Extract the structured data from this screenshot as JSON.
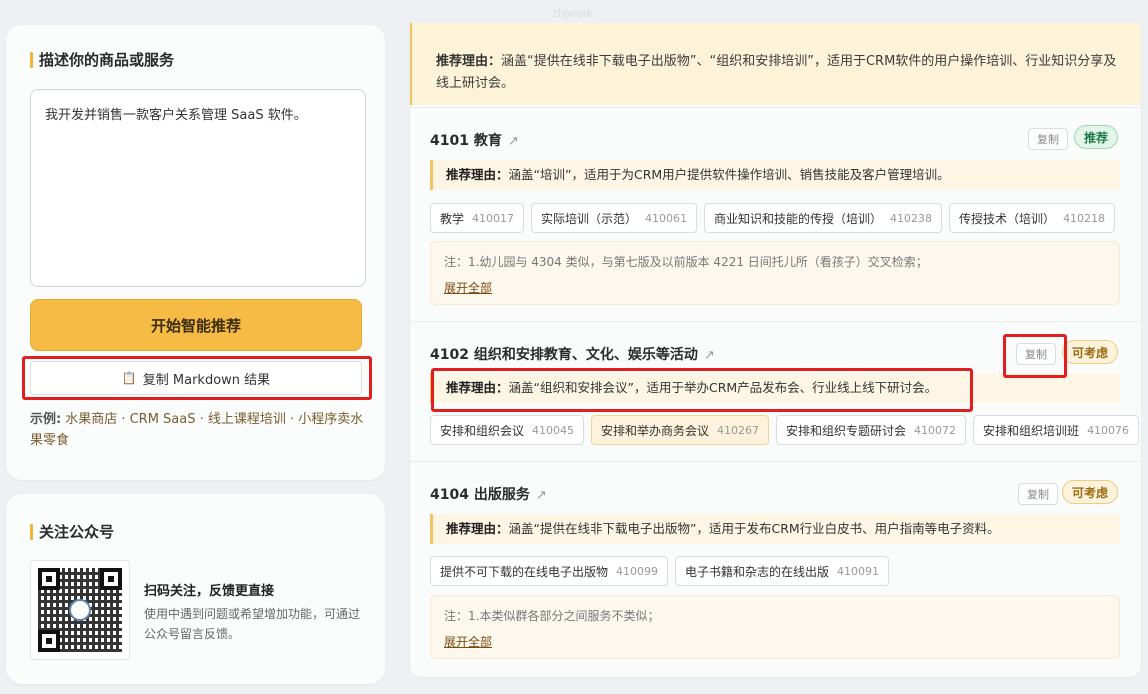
{
  "watermark": "zhjwork",
  "describe": {
    "title": "描述你的商品或服务",
    "input_value": "我开发并销售一款客户关系管理 SaaS 软件。",
    "start_button": "开始智能推荐",
    "copy_md_button": "复制 Markdown 结果",
    "examples_label": "示例:",
    "examples_text": "水果商店 · CRM SaaS · 线上课程培训 · 小程序卖水果零食"
  },
  "wechat": {
    "title": "关注公众号",
    "scan_title": "扫码关注，反馈更直接",
    "scan_desc": "使用中遇到问题或希望增加功能，可通过公众号留言反馈。"
  },
  "top_reason": {
    "label": "推荐理由：",
    "text": "涵盖“提供在线非下载电子出版物”、“组织和安排培训”，适用于CRM软件的用户操作培训、行业知识分享及线上研讨会。"
  },
  "classes": [
    {
      "code_title": "4101 教育",
      "copy_label": "复制",
      "badge": "推荐",
      "reason_label": "推荐理由：",
      "reason_text": "涵盖“培训”，适用于为CRM用户提供软件操作培训、销售技能及客户管理培训。",
      "tags": [
        {
          "name": "教学",
          "code": "410017",
          "highlight": false
        },
        {
          "name": "实际培训（示范）",
          "code": "410061",
          "highlight": false
        },
        {
          "name": "商业知识和技能的传授（培训）",
          "code": "410238",
          "highlight": false
        },
        {
          "name": "传授技术（培训）",
          "code": "410218",
          "highlight": false
        }
      ],
      "note": "注：1.幼儿园与 4304 类似，与第七版及以前版本 4221 日间托儿所（看孩子）交叉检索；",
      "expand": "展开全部"
    },
    {
      "code_title": "4102 组织和安排教育、文化、娱乐等活动",
      "copy_label": "复制",
      "badge": "可考虑",
      "reason_label": "推荐理由：",
      "reason_text": "涵盖“组织和安排会议”，适用于举办CRM产品发布会、行业线上线下研讨会。",
      "tags": [
        {
          "name": "安排和组织会议",
          "code": "410045",
          "highlight": false
        },
        {
          "name": "安排和举办商务会议",
          "code": "410267",
          "highlight": true
        },
        {
          "name": "安排和组织专题研讨会",
          "code": "410072",
          "highlight": false
        },
        {
          "name": "安排和组织培训班",
          "code": "410076",
          "highlight": false
        }
      ]
    },
    {
      "code_title": "4104 出版服务",
      "copy_label": "复制",
      "badge": "可考虑",
      "reason_label": "推荐理由：",
      "reason_text": "涵盖“提供在线非下载电子出版物”，适用于发布CRM行业白皮书、用户指南等电子资料。",
      "tags": [
        {
          "name": "提供不可下载的在线电子出版物",
          "code": "410099",
          "highlight": false
        },
        {
          "name": "电子书籍和杂志的在线出版",
          "code": "410091",
          "highlight": false
        }
      ],
      "note": "注：1.本类似群各部分之间服务不类似；",
      "expand": "展开全部"
    }
  ],
  "colors": {
    "accent": "#f5bb45",
    "highlight_box": "#e41e1e",
    "recommend_badge": "#1d7a45",
    "maybe_badge": "#9a6a10"
  }
}
